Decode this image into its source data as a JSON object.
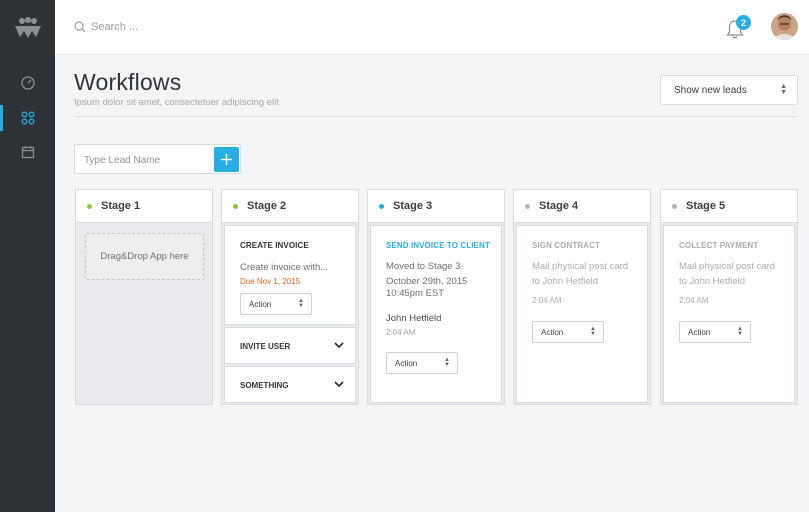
{
  "header": {
    "search_placeholder": "Search ...",
    "notification_count": "2"
  },
  "page": {
    "title": "Workflows",
    "subtitle": "Ipsum dolor sit amet, consectetuer adipiscing elit",
    "leads_filter": "Show new leads"
  },
  "lead": {
    "placeholder": "Type Lead Name"
  },
  "colors": {
    "accent": "#29aee3",
    "stage_active": "#8cc63f",
    "stage_inactive": "#b0b5ba",
    "due": "#e8601c",
    "sidebar": "#2d3236"
  },
  "stages": [
    {
      "name": "Stage 1",
      "drop_label": "Drag&Drop App here"
    },
    {
      "name": "Stage 2",
      "card": {
        "title": "CREATE INVOICE",
        "text": "Create invoice with...",
        "due": "Due Nov 1, 2015",
        "action": "Action"
      },
      "folds": [
        "INVITE USER",
        "SOMETHING"
      ]
    },
    {
      "name": "Stage 3",
      "card": {
        "title": "SEND INVOICE TO CLIENT",
        "line1": "Moved to Stage 3",
        "line2": "October 29th, 2015",
        "line3": "10:45pm EST",
        "person": "John Hetfield",
        "time": "2:04 AM",
        "action": "Action"
      }
    },
    {
      "name": "Stage 4",
      "card": {
        "title": "SIGN CONTRACT",
        "line1": "Mail physical post card",
        "line2": "to John Hetfield",
        "time": "2:04 AM",
        "action": "Action"
      }
    },
    {
      "name": "Stage 5",
      "card": {
        "title": "COLLECT PAYMENT",
        "line1": "Mail physical post card",
        "line2": "to John Hetfield",
        "time": "2:04 AM",
        "action": "Action"
      }
    }
  ]
}
